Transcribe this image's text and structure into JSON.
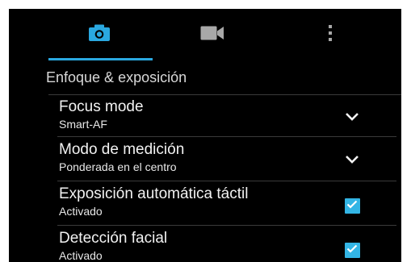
{
  "tabs": [
    {
      "icon": "camera-icon",
      "active": true
    },
    {
      "icon": "video-camera-icon",
      "active": false
    },
    {
      "icon": "more-vert-icon",
      "active": false
    }
  ],
  "accent_color": "#2aa8e0",
  "checkbox_color": "#33b5e5",
  "section": {
    "title": "Enfoque & exposición"
  },
  "settings": [
    {
      "title": "Focus mode",
      "value": "Smart-AF",
      "control": "dropdown"
    },
    {
      "title": "Modo de medición",
      "value": "Ponderada en el centro",
      "control": "dropdown"
    },
    {
      "title": "Exposición automática táctil",
      "value": "Activado",
      "control": "checkbox",
      "checked": true
    },
    {
      "title": "Detección facial",
      "value": "Activado",
      "control": "checkbox",
      "checked": true
    }
  ]
}
